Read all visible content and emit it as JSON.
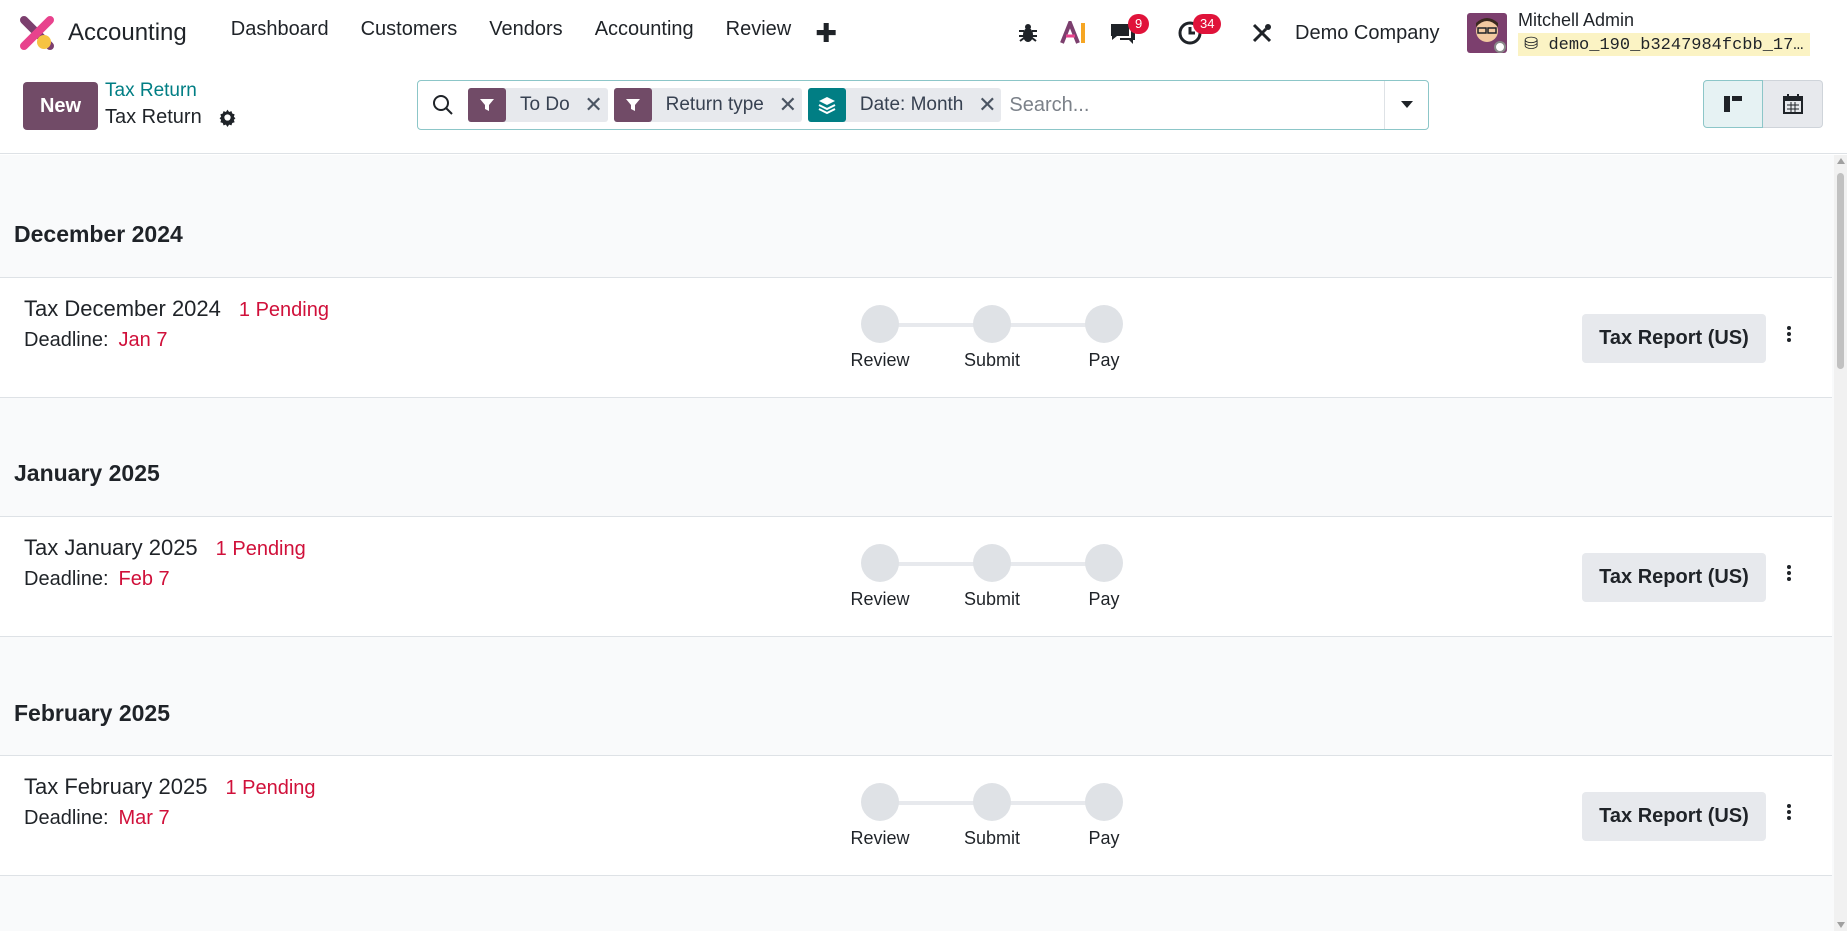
{
  "app": {
    "name": "Accounting"
  },
  "menu": [
    "Dashboard",
    "Customers",
    "Vendors",
    "Accounting",
    "Review"
  ],
  "systray": {
    "messages_count": "9",
    "activities_count": "34",
    "company": "Demo Company",
    "user_name": "Mitchell Admin",
    "database": "demo_190_b3247984fcbb_17…"
  },
  "control_panel": {
    "new_label": "New",
    "breadcrumb_parent": "Tax Return",
    "breadcrumb_current": "Tax Return"
  },
  "search": {
    "facets": [
      {
        "label": "To Do",
        "icon": "filter-icon",
        "color": "#714b67"
      },
      {
        "label": "Return type",
        "icon": "filter-icon",
        "color": "#714b67"
      },
      {
        "label": "Date: Month",
        "icon": "group-by-icon",
        "color": "#017e84"
      }
    ],
    "placeholder": "Search..."
  },
  "groups": [
    {
      "title": "December 2024",
      "record": {
        "name": "Tax December 2024",
        "pending": "1 Pending",
        "deadline_label": "Deadline:",
        "deadline": "Jan 7",
        "steps": [
          "Review",
          "Submit",
          "Pay"
        ],
        "report_button": "Tax Report (US)"
      }
    },
    {
      "title": "January 2025",
      "record": {
        "name": "Tax January 2025",
        "pending": "1 Pending",
        "deadline_label": "Deadline:",
        "deadline": "Feb 7",
        "steps": [
          "Review",
          "Submit",
          "Pay"
        ],
        "report_button": "Tax Report (US)"
      }
    },
    {
      "title": "February 2025",
      "record": {
        "name": "Tax February 2025",
        "pending": "1 Pending",
        "deadline_label": "Deadline:",
        "deadline": "Mar 7",
        "steps": [
          "Review",
          "Submit",
          "Pay"
        ],
        "report_button": "Tax Report (US)"
      }
    }
  ],
  "colors": {
    "brand": "#714b67",
    "accent": "#017e84",
    "danger": "#d0103a"
  }
}
